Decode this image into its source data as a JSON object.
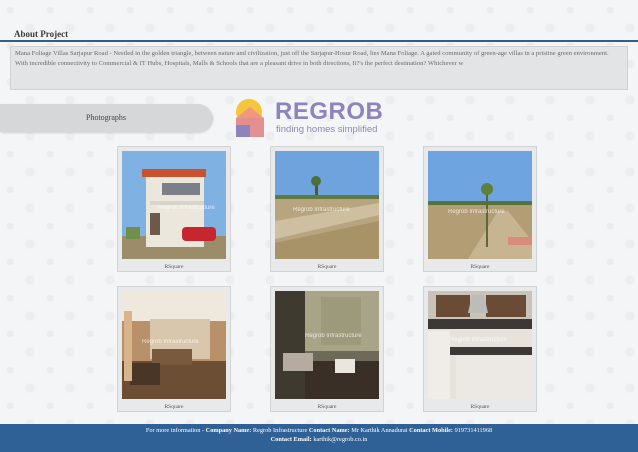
{
  "about": {
    "title": "About Project",
    "text": "Mana Foliage Villas Sarjapur Road - Nestled in the golden triangle, between nature and civilization, just off the Sarjapur-Hosur Road, lies Mana Foliage. A gated community of green-age villas in a pristine green environment. With incredible connectivity to Commercial & IT Hubs, Hospitals, Malls & Schools that are a pleasant drive in both directions, It?'s the perfect destination? Whichever w"
  },
  "photos": {
    "label": "Photographs",
    "items": [
      {
        "caption": "RSquare",
        "watermark": "Regrob Infrastructure"
      },
      {
        "caption": "RSquare",
        "watermark": "Regrob Infrastructure"
      },
      {
        "caption": "RSquare",
        "watermark": "Regrob Infrastructure"
      },
      {
        "caption": "RSquare",
        "watermark": "Regrob Infrastructure"
      },
      {
        "caption": "RSquare",
        "watermark": "Regrob Infrastructure"
      },
      {
        "caption": "RSquare",
        "watermark": "Regrob Infrastructure"
      }
    ]
  },
  "logo": {
    "name": "REGROB",
    "tagline": "finding homes simplified",
    "colors": {
      "text": "#8e83bd",
      "yellow": "#f5c53b",
      "pink": "#ee8f8a",
      "purple": "#8e83bd"
    }
  },
  "footer": {
    "intro": "For more information -",
    "company_label": "Company Name:",
    "company_value": "Regrob Infrastructure",
    "contact_label": "Contact Name:",
    "contact_value": "Mr Karthik Annadurai",
    "mobile_label": "Contact Mobile:",
    "mobile_value": "919731411968",
    "email_label": "Contact Email:",
    "email_value": "karthik@regrob.co.in",
    "bg_color": "#2f6196"
  }
}
